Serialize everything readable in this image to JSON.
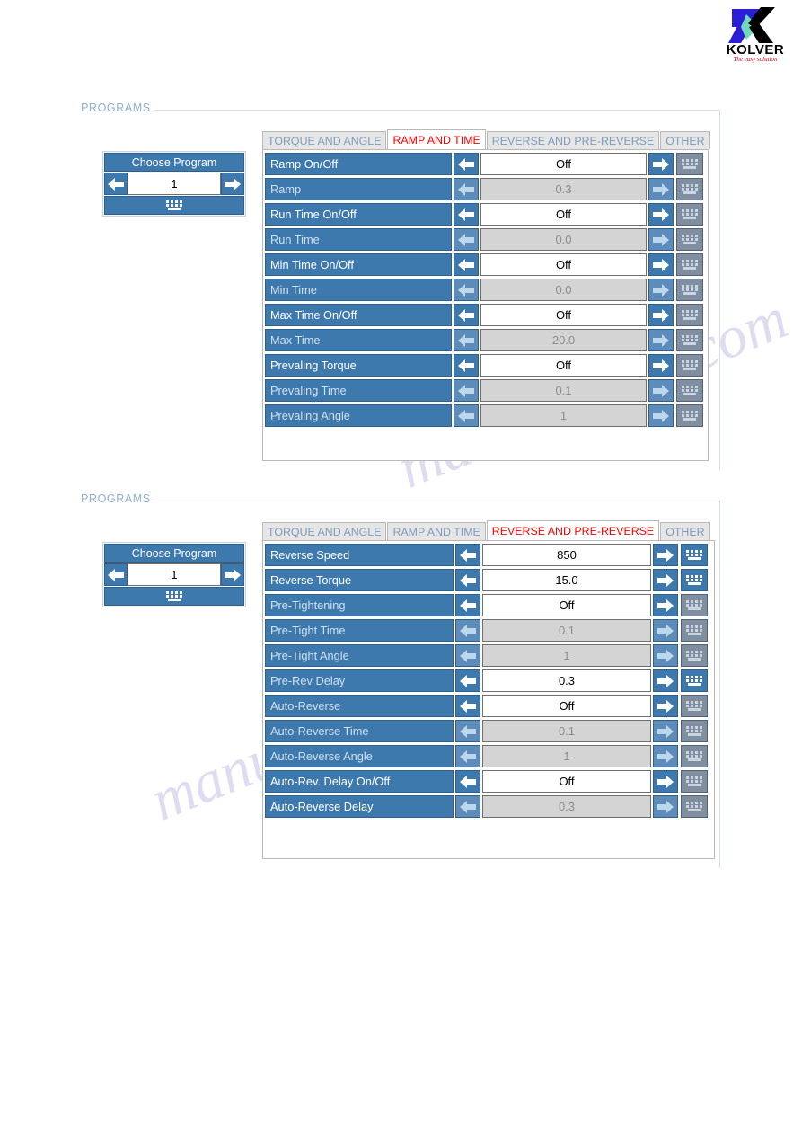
{
  "logo": {
    "name": "kolver-logo",
    "wordmark": "KOLVER",
    "tagline": "The easy solution",
    "colors": {
      "k_blue": "#2b1ed6",
      "k_teal": "#6fd9c0",
      "k_black": "#000000",
      "tagline_red": "#e2001a"
    }
  },
  "watermark": {
    "line1": "manualshive.com",
    "line2": "manualshive.com"
  },
  "colors": {
    "row_blue": "#3e79ae",
    "row_blue_border": "#2f5f8c",
    "row_blue_disabled": "#5d8cbb",
    "value_disabled_bg": "#d4d4d4",
    "value_disabled_text": "#8c8c8c",
    "tab_active_text": "#ff0000",
    "tab_inactive_text": "#7d9cba",
    "legend_text": "#8fb0cf",
    "keyboard_disabled": "#7f8fa0"
  },
  "panels": [
    {
      "legend": "PROGRAMS",
      "chooser": {
        "title": "Choose Program",
        "prev_icon": "arrow-left-icon",
        "value": "1",
        "next_icon": "arrow-right-icon",
        "keyboard_icon": "keyboard-icon"
      },
      "tabs": [
        {
          "label": "TORQUE AND ANGLE",
          "active": false
        },
        {
          "label": "RAMP AND TIME",
          "active": true
        },
        {
          "label": "REVERSE AND PRE-REVERSE",
          "active": false
        },
        {
          "label": "OTHER",
          "active": false
        }
      ],
      "rows": [
        {
          "label": "Ramp On/Off",
          "value": "Off",
          "enabled": true
        },
        {
          "label": "Ramp",
          "value": "0.3",
          "enabled": false
        },
        {
          "label": "Run Time On/Off",
          "value": "Off",
          "enabled": true
        },
        {
          "label": "Run Time",
          "value": "0.0",
          "enabled": false
        },
        {
          "label": "Min Time On/Off",
          "value": "Off",
          "enabled": true
        },
        {
          "label": "Min Time",
          "value": "0.0",
          "enabled": false
        },
        {
          "label": "Max Time On/Off",
          "value": "Off",
          "enabled": true
        },
        {
          "label": "Max Time",
          "value": "20.0",
          "enabled": false
        },
        {
          "label": "Prevaling Torque",
          "value": "Off",
          "enabled": true
        },
        {
          "label": "Prevaling Time",
          "value": "0.1",
          "enabled": false
        },
        {
          "label": "Prevaling Angle",
          "value": "1",
          "enabled": false
        }
      ]
    },
    {
      "legend": "PROGRAMS",
      "chooser": {
        "title": "Choose Program",
        "prev_icon": "arrow-left-icon",
        "value": "1",
        "next_icon": "arrow-right-icon",
        "keyboard_icon": "keyboard-icon"
      },
      "tabs": [
        {
          "label": "TORQUE AND ANGLE",
          "active": false
        },
        {
          "label": "RAMP AND TIME",
          "active": false
        },
        {
          "label": "REVERSE AND PRE-REVERSE",
          "active": true
        },
        {
          "label": "OTHER",
          "active": false
        }
      ],
      "rows": [
        {
          "label": "Reverse Speed",
          "value": "850",
          "enabled": true,
          "keyboard": true
        },
        {
          "label": "Reverse Torque",
          "value": "15.0",
          "enabled": true,
          "keyboard": true
        },
        {
          "label": "Pre-Tightening",
          "value": "Off",
          "enabled": true,
          "keyboard": false
        },
        {
          "label": "Pre-Tight Time",
          "value": "0.1",
          "enabled": false,
          "keyboard": false
        },
        {
          "label": "Pre-Tight Angle",
          "value": "1",
          "enabled": false,
          "keyboard": false
        },
        {
          "label": "Pre-Rev Delay",
          "value": "0.3",
          "enabled": true,
          "keyboard": true
        },
        {
          "label": "Auto-Reverse",
          "value": "Off",
          "enabled": true,
          "keyboard": false
        },
        {
          "label": "Auto-Reverse Time",
          "value": "0.1",
          "enabled": false,
          "keyboard": false
        },
        {
          "label": "Auto-Reverse Angle",
          "value": "1",
          "enabled": false,
          "keyboard": false
        },
        {
          "label": "Auto-Rev. Delay On/Off",
          "value": "Off",
          "enabled": true,
          "keyboard": false
        },
        {
          "label": "Auto-Reverse Delay",
          "value": "0.3",
          "enabled": false,
          "keyboard": false
        }
      ]
    }
  ]
}
